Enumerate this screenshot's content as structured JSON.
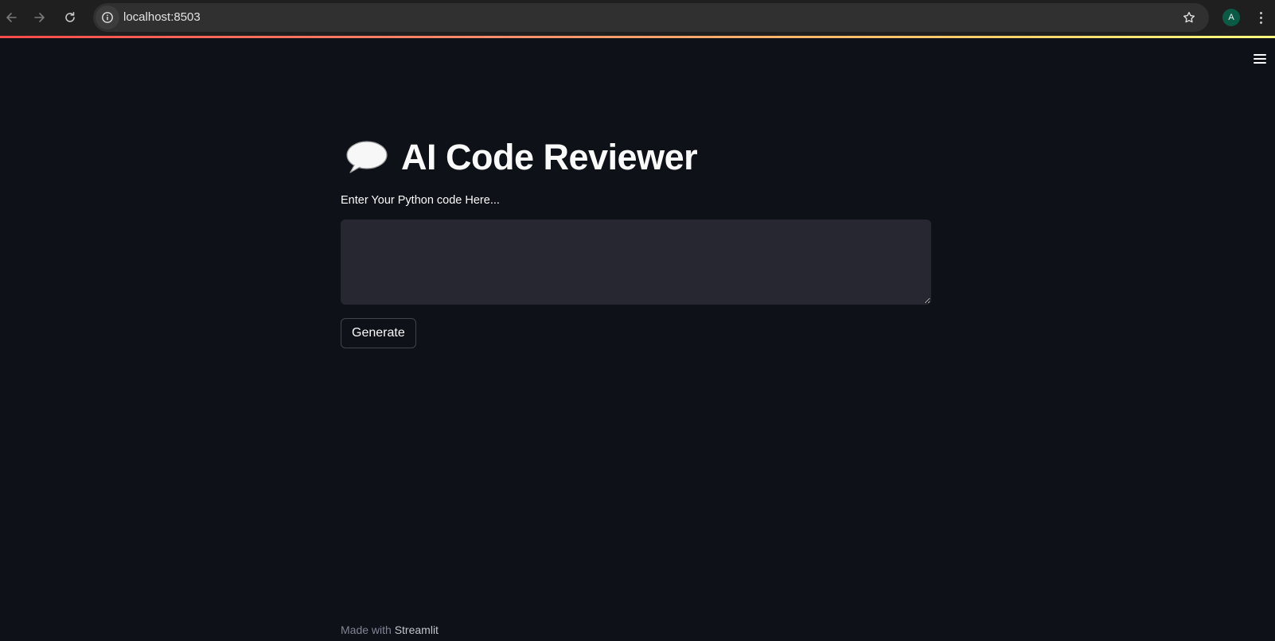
{
  "browser": {
    "url": "localhost:8503",
    "avatar_initial": "A",
    "icons": {
      "back": "arrow-left-icon",
      "forward": "arrow-right-icon",
      "reload": "reload-icon",
      "site_info": "info-icon",
      "bookmark": "star-icon",
      "menu": "kebab-menu-icon"
    }
  },
  "app": {
    "title_icon": "speech-bubble-icon",
    "title": "AI Code Reviewer",
    "input_label": "Enter Your Python code Here...",
    "input_value": "",
    "generate_label": "Generate",
    "footer_prefix": "Made with",
    "footer_brand": "Streamlit",
    "menu_icon": "hamburger-menu-icon"
  },
  "colors": {
    "background": "#0e1117",
    "textarea_bg": "#262730",
    "text": "#fafafa",
    "accent": "#ff4b4b"
  }
}
